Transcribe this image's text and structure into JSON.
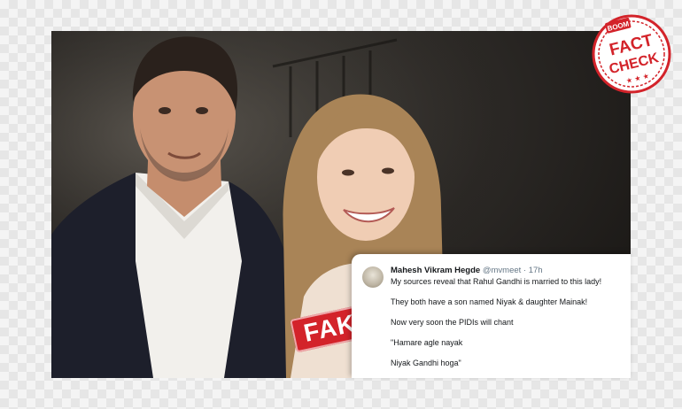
{
  "stamp": {
    "fake_label": "FAKE"
  },
  "tweet": {
    "author_name": "Mahesh Vikram Hegde",
    "handle": "@mvmeet",
    "separator": "·",
    "time": "17h",
    "lines": [
      "My sources reveal that Rahul Gandhi is married to this lady!",
      "They both have a son named Niyak & daughter Mainak!",
      "Now very soon the PIDIs will chant",
      "\"Hamare agle nayak",
      "Niyak Gandhi hoga\""
    ]
  },
  "badge": {
    "brand": "BOOM",
    "line1": "FACT",
    "line2": "CHECK"
  },
  "colors": {
    "stamp_red": "#d3232a",
    "tweet_text": "#14171a",
    "tweet_meta": "#657786"
  }
}
